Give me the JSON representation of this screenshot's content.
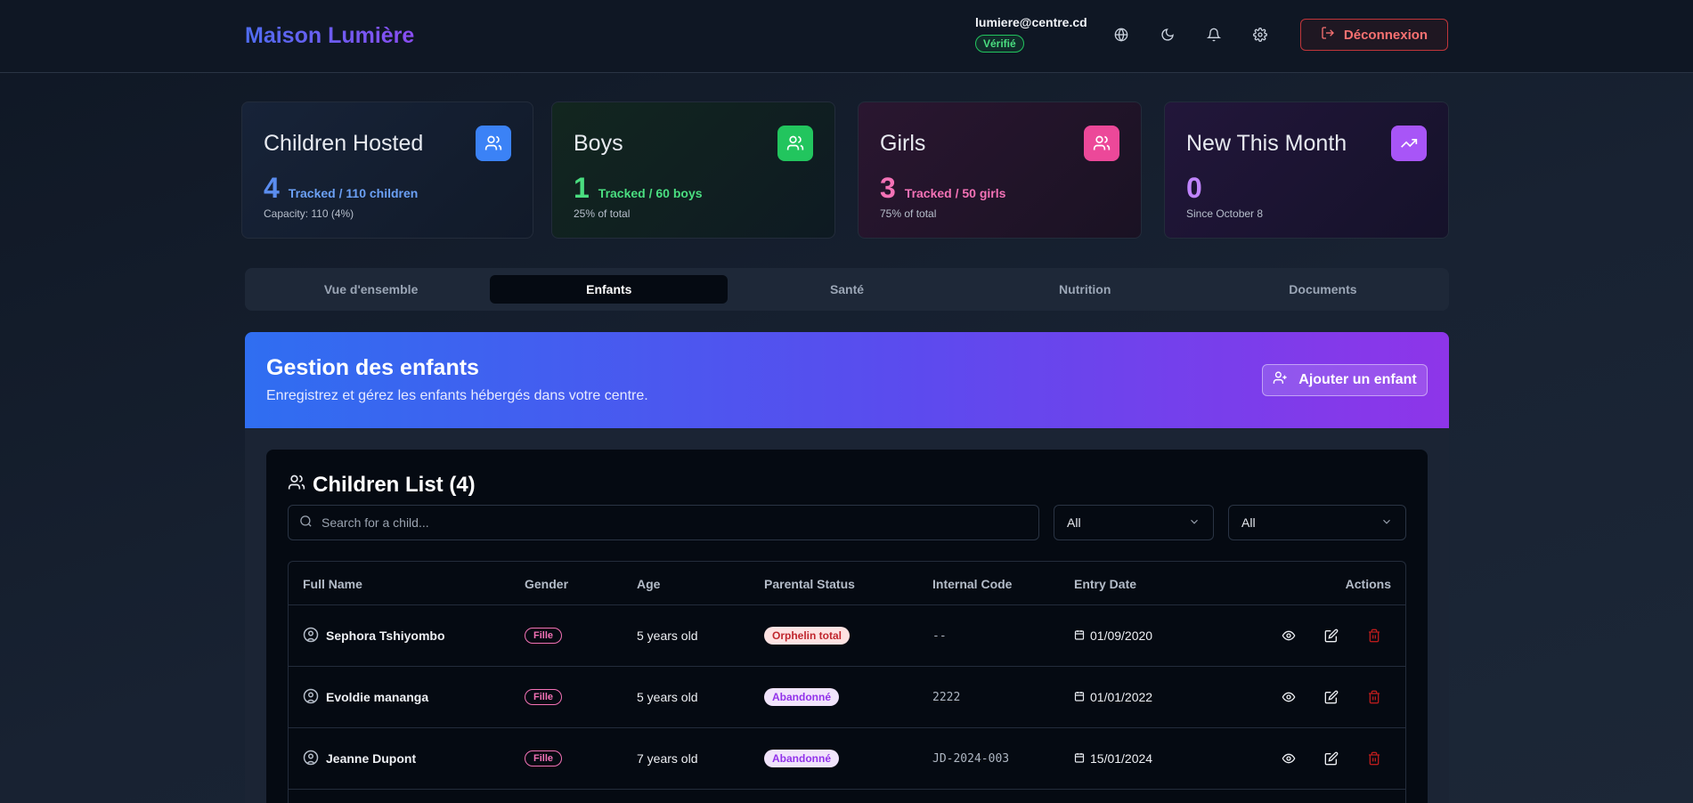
{
  "header": {
    "brand": "Maison Lumière",
    "user_email": "lumiere@centre.cd",
    "verified_label": "Vérifié",
    "logout_label": "Déconnexion"
  },
  "stats": [
    {
      "title": "Children Hosted",
      "value": "4",
      "tracked": "Tracked / 110 children",
      "sub": "Capacity: 110 (4%)",
      "accent": "#5b8def",
      "icon_bg": "#3b82f6",
      "icon": "users-icon"
    },
    {
      "title": "Boys",
      "value": "1",
      "tracked": "Tracked / 60 boys",
      "sub": "25% of total",
      "accent": "#4ade80",
      "icon_bg": "#22c55e",
      "icon": "users-icon"
    },
    {
      "title": "Girls",
      "value": "3",
      "tracked": "Tracked / 50 girls",
      "sub": "75% of total",
      "accent": "#f472b6",
      "icon_bg": "#ec4899",
      "icon": "users-icon"
    },
    {
      "title": "New This Month",
      "value": "0",
      "tracked": "",
      "sub": "Since October 8",
      "accent": "#c084fc",
      "icon_bg": "#a855f7",
      "icon": "trending-up-icon"
    }
  ],
  "tabs": [
    "Vue d'ensemble",
    "Enfants",
    "Santé",
    "Nutrition",
    "Documents"
  ],
  "banner": {
    "title": "Gestion des enfants",
    "subtitle": "Enregistrez et gérez les enfants hébergés dans votre centre.",
    "add_label": "Ajouter un enfant"
  },
  "list": {
    "title": "Children List (4)",
    "search_placeholder": "Search for a child...",
    "filter1": "All",
    "filter2": "All",
    "columns": [
      "Full Name",
      "Gender",
      "Age",
      "Parental Status",
      "Internal Code",
      "Entry Date",
      "Actions"
    ],
    "rows": [
      {
        "name": "Sephora Tshiyombo",
        "gender": "Fille",
        "age": "5 years old",
        "status": "Orphelin total",
        "code": "--",
        "date": "01/09/2020"
      },
      {
        "name": "Evoldie mananga",
        "gender": "Fille",
        "age": "5 years old",
        "status": "Abandonné",
        "code": "2222",
        "date": "01/01/2022"
      },
      {
        "name": "Jeanne Dupont",
        "gender": "Fille",
        "age": "7 years old",
        "status": "Abandonné",
        "code": "JD-2024-003",
        "date": "15/01/2024"
      }
    ]
  },
  "colors": {
    "orphelin_bg": "#fde2e2",
    "orphelin_fg": "#c0262d",
    "abandon_bg": "#f1e4fb",
    "abandon_fg": "#9333ea",
    "delete": "#dc2626"
  }
}
